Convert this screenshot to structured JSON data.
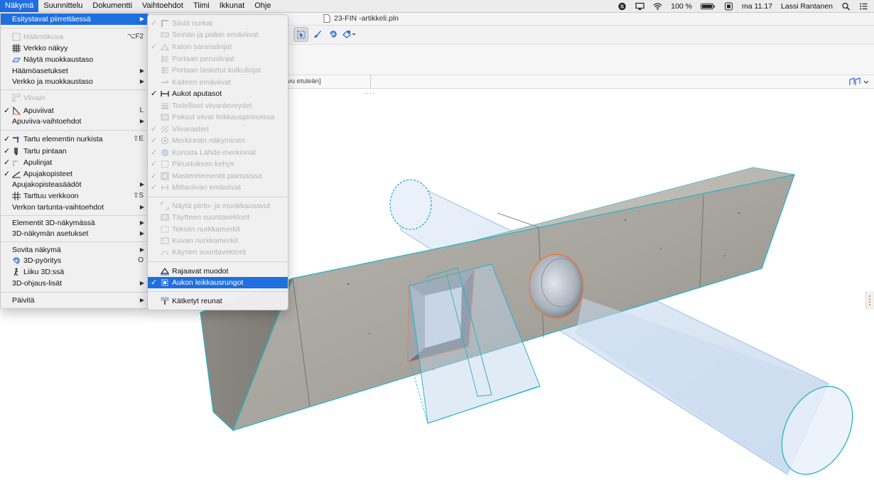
{
  "menubar": {
    "items": [
      "Näkymä",
      "Suunnittelu",
      "Dokumentti",
      "Vaihtoehdot",
      "Tiimi",
      "Ikkunat",
      "Ohje"
    ],
    "battery": "100 %",
    "clock": "ma 11.17",
    "user": "Lassi Rantanen"
  },
  "window": {
    "doc_title": "23-FIN -artikkeli.pln",
    "tab_text": "vu etuleän]"
  },
  "main_menu": {
    "items": [
      {
        "label": "Esitystavat piirrettäessä",
        "submenu": true,
        "highlight": true
      },
      {
        "label": "Häämökuva",
        "disabled": true,
        "shortcut": "⌥F2"
      },
      {
        "label": "Verkko näkyy"
      },
      {
        "label": "Näytä muokkaustaso"
      },
      {
        "label": "Häämöasetukset",
        "submenu": true
      },
      {
        "label": "Verkko ja muokkaustaso",
        "submenu": true
      },
      {
        "label": "Viivain",
        "disabled": true
      },
      {
        "label": "Apuviivat",
        "checked": true,
        "shortcut": "L"
      },
      {
        "label": "Apuviiva-vaihtoehdot",
        "submenu": true
      },
      {
        "label": "Tartu elementin nurkista",
        "checked": true,
        "shortcut": "⇧E"
      },
      {
        "label": "Tartu pintaan",
        "checked": true
      },
      {
        "label": "Apulinjat",
        "checked": true
      },
      {
        "label": "Apujakopisteet",
        "checked": true
      },
      {
        "label": "Apujakopisteasäädöt",
        "submenu": true
      },
      {
        "label": "Tarttuu verkkoon",
        "shortcut": "⇧S"
      },
      {
        "label": "Verkon tartunta-vaihtoehdot",
        "submenu": true
      },
      {
        "label": "Elementit 3D-näkymässä",
        "submenu": true
      },
      {
        "label": "3D-näkymän asetukset",
        "submenu": true
      },
      {
        "label": "Sovita näkymä",
        "submenu": true
      },
      {
        "label": "3D-pyöritys",
        "shortcut": "O"
      },
      {
        "label": "Liiku 3D:ssä"
      },
      {
        "label": "3D-ohjaus-lisät",
        "submenu": true
      },
      {
        "label": "Päivitä",
        "submenu": true
      }
    ]
  },
  "sub_menu": {
    "items": [
      {
        "label": "Siistit nurkat",
        "checked": true,
        "disabled": true
      },
      {
        "label": "Seinän ja palkin emäviivat",
        "disabled": true
      },
      {
        "label": "Katon saranalinjat",
        "checked": true,
        "disabled": true
      },
      {
        "label": "Portaan peruslinjat",
        "disabled": true
      },
      {
        "label": "Portaan lasketut kulkulinjat",
        "disabled": true
      },
      {
        "label": "Kaiteen emäviivat",
        "disabled": true
      },
      {
        "label": "Aukot aputasot",
        "checked": true
      },
      {
        "label": "Todelliset viivanleveydet",
        "disabled": true
      },
      {
        "label": "Paksut viivat leikkauspinnoissa",
        "disabled": true
      },
      {
        "label": "Viivarasteri",
        "checked": true,
        "disabled": true
      },
      {
        "label": "Merkinnän näkyminen",
        "checked": true,
        "disabled": true
      },
      {
        "label": "Korosta Lähde-merkinnät",
        "checked": true,
        "disabled": true
      },
      {
        "label": "Piirustuksen kehys",
        "checked": true,
        "disabled": true
      },
      {
        "label": "Masterelementit pianssissa",
        "checked": true,
        "disabled": true
      },
      {
        "label": "Mittaviivan emäviivat",
        "checked": true,
        "disabled": true
      },
      {
        "label": "Näytä piirto- ja muokkausavut",
        "disabled": true
      },
      {
        "label": "Täytteen suuntavektorit",
        "disabled": true
      },
      {
        "label": "Tekstin nurkkamerkit",
        "disabled": true
      },
      {
        "label": "Kuvan nurkkamerkit",
        "disabled": true
      },
      {
        "label": "Käyrien suuntavektorit",
        "disabled": true
      },
      {
        "label": "Rajaavat muodot"
      },
      {
        "label": "Aukon leikkausrungot",
        "checked": true,
        "highlight": true
      },
      {
        "label": "Kätketyt reunat"
      }
    ]
  },
  "colors": {
    "accent": "#1f6fe0",
    "selection_outline": "#22b5c8",
    "cut_outline": "#f07a3a",
    "ghost_fill": "#cfe0f2"
  }
}
